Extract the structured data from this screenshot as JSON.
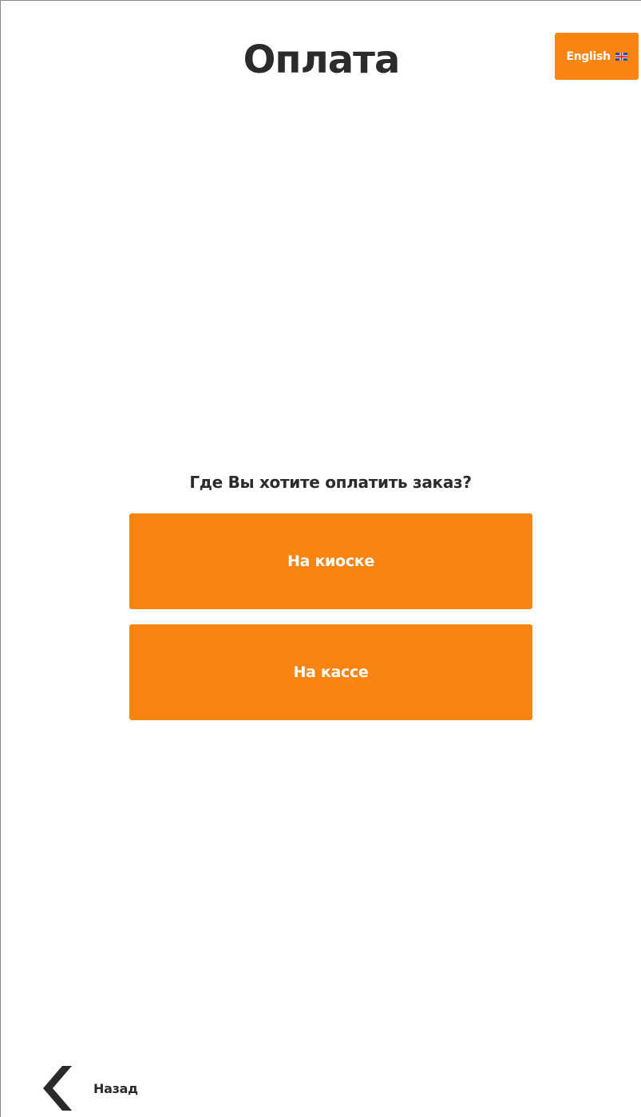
{
  "header": {
    "title": "Оплата",
    "language_button": {
      "label": "English",
      "icon": "uk-flag-icon"
    }
  },
  "main": {
    "question": "Где Вы хотите оплатить заказ?",
    "options": [
      {
        "label": "На киоске"
      },
      {
        "label": "На кассе"
      }
    ]
  },
  "footer": {
    "back_label": "Назад",
    "back_icon": "chevron-left-icon"
  },
  "colors": {
    "accent": "#fa8412",
    "text": "#2b2b2b",
    "background": "#ffffff"
  }
}
